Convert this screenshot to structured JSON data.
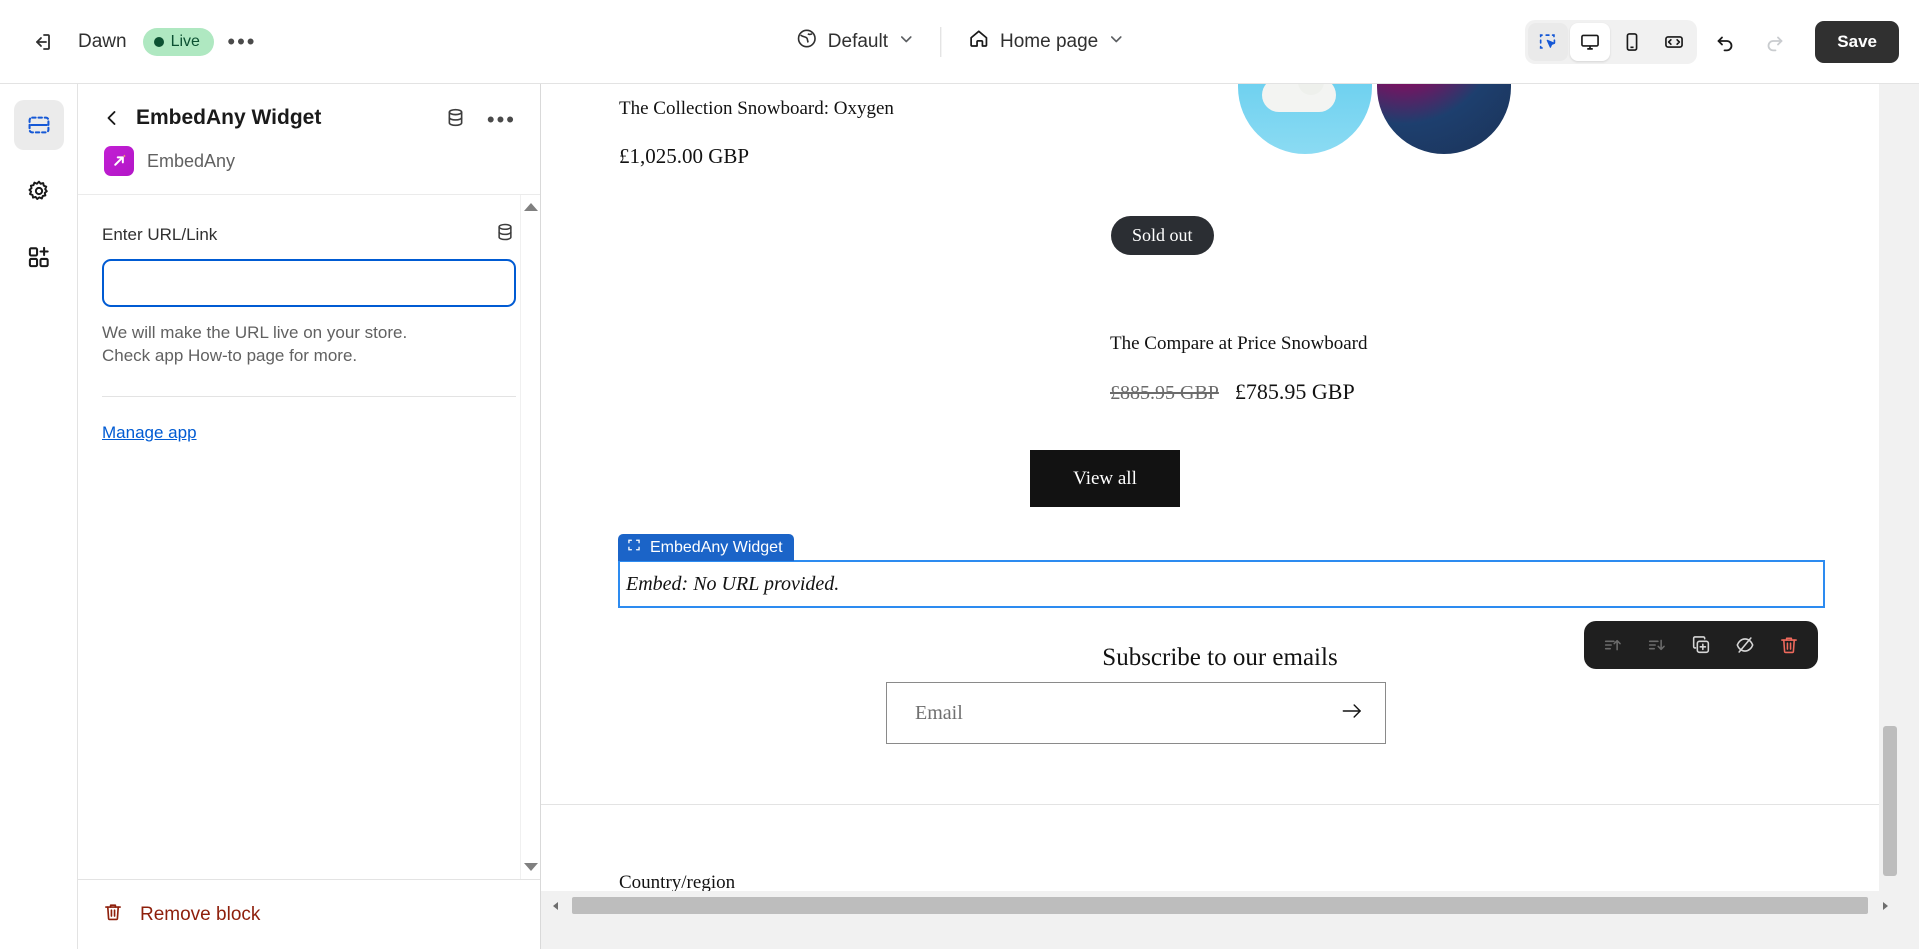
{
  "topbar": {
    "exit_icon": "exit-icon",
    "theme_name": "Dawn",
    "live_label": "Live",
    "more_label": "•••",
    "locale_selector": {
      "icon": "globe-icon",
      "label": "Default",
      "chevron": "chevron-down-icon"
    },
    "page_selector": {
      "icon": "home-icon",
      "label": "Home page",
      "chevron": "chevron-down-icon"
    },
    "view_modes": [
      {
        "name": "inspector-mode",
        "icon": "cursor-select-icon",
        "active": true
      },
      {
        "name": "desktop-view",
        "icon": "desktop-icon",
        "active": true
      },
      {
        "name": "mobile-view",
        "icon": "mobile-icon",
        "active": false
      },
      {
        "name": "fullscreen-view",
        "icon": "full-width-icon",
        "active": false
      }
    ],
    "undo_icon": "undo-icon",
    "redo_icon": "redo-icon",
    "save_label": "Save"
  },
  "rail": {
    "items": [
      {
        "name": "sections-tab",
        "icon": "sections-icon",
        "active": true
      },
      {
        "name": "theme-settings-tab",
        "icon": "gear-icon",
        "active": false
      },
      {
        "name": "apps-tab",
        "icon": "apps-grid-icon",
        "active": false
      }
    ]
  },
  "panel": {
    "back_icon": "chevron-left-icon",
    "title": "EmbedAny Widget",
    "header_icons": [
      {
        "name": "dynamic-source-icon",
        "icon": "database-icon"
      },
      {
        "name": "block-more-menu",
        "icon": "ellipsis-icon"
      }
    ],
    "app_name": "EmbedAny",
    "app_logo_icon": "embedany-logo-icon",
    "field": {
      "label": "Enter URL/Link",
      "dynamic_icon": "database-icon",
      "value": "",
      "placeholder": "",
      "helper_line1": "We will make the URL live on your store.",
      "helper_line2": "Check app How-to page for more."
    },
    "manage_app_label": "Manage app",
    "remove_block_label": "Remove block",
    "remove_block_icon": "trash-icon"
  },
  "preview": {
    "product_left": {
      "title": "The Collection Snowboard: Oxygen",
      "price": "£1,025.00 GBP"
    },
    "sold_out_badge": "Sold out",
    "product_right": {
      "title": "The Compare at Price Snowboard",
      "price_old": "£885.95 GBP",
      "price_new": "£785.95 GBP"
    },
    "view_all_label": "View all",
    "embed_block": {
      "badge_icon": "block-frame-icon",
      "badge_label": "EmbedAny Widget",
      "content_text": "Embed: No URL provided."
    },
    "float_toolbar": [
      {
        "name": "move-up-button",
        "icon": "move-up-icon",
        "disabled": true
      },
      {
        "name": "move-down-button",
        "icon": "move-down-icon",
        "disabled": true
      },
      {
        "name": "duplicate-button",
        "icon": "duplicate-icon",
        "disabled": false
      },
      {
        "name": "hide-button",
        "icon": "eye-off-icon",
        "disabled": false
      },
      {
        "name": "delete-button",
        "icon": "trash-icon",
        "disabled": false
      }
    ],
    "subscribe_title": "Subscribe to our emails",
    "email_placeholder": "Email",
    "email_submit_icon": "arrow-right-icon",
    "country_label": "Country/region"
  },
  "colors": {
    "accent_blue": "#005bd3",
    "block_blue": "#1b64c8",
    "live_green_bg": "#afe8c1",
    "live_green_fg": "#0c5132",
    "danger_red": "#8e1f0b",
    "toolbar_dark": "#1f1f1f",
    "brand_magenta": "#c21fd4"
  }
}
